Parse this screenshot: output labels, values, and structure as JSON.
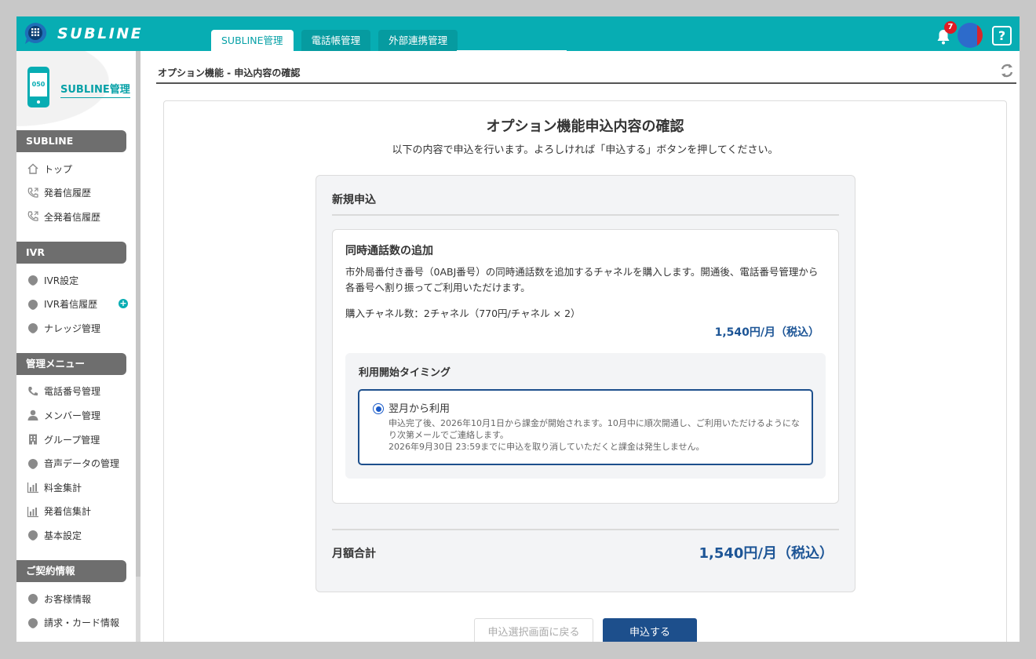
{
  "app": {
    "logo_text": "SUBLINE",
    "tabs": [
      {
        "label": "SUBLINE管理",
        "active": true
      },
      {
        "label": "電話帳管理",
        "active": false
      },
      {
        "label": "外部連携管理",
        "active": false
      }
    ],
    "notification_count": "7",
    "help_label": "?",
    "accent_color": "#07adb3",
    "primary_color": "#1d4f8c"
  },
  "sidebar": {
    "phone_number_prefix": "050",
    "title": "SUBLINE管理",
    "sections": [
      {
        "heading": "SUBLINE",
        "items": [
          {
            "label": "トップ",
            "icon": "home-icon"
          },
          {
            "label": "発着信履歴",
            "icon": "phone-call-icon"
          },
          {
            "label": "全発着信履歴",
            "icon": "phone-call-icon"
          }
        ]
      },
      {
        "heading": "IVR",
        "items": [
          {
            "label": "IVR設定",
            "icon": "pin-icon"
          },
          {
            "label": "IVR着信履歴",
            "icon": "pin-icon"
          },
          {
            "label": "ナレッジ管理",
            "icon": "pin-icon"
          }
        ]
      },
      {
        "heading": "管理メニュー",
        "items": [
          {
            "label": "電話番号管理",
            "icon": "phone-icon"
          },
          {
            "label": "メンバー管理",
            "icon": "user-icon"
          },
          {
            "label": "グループ管理",
            "icon": "building-icon"
          },
          {
            "label": "音声データの管理",
            "icon": "pin-icon"
          },
          {
            "label": "料金集計",
            "icon": "bar-chart-icon"
          },
          {
            "label": "発着信集計",
            "icon": "bar-chart-icon"
          },
          {
            "label": "基本設定",
            "icon": "pin-icon"
          }
        ]
      },
      {
        "heading": "ご契約情報",
        "items": [
          {
            "label": "お客様情報",
            "icon": "pin-icon"
          },
          {
            "label": "請求・カード情報",
            "icon": "pin-icon"
          }
        ]
      }
    ]
  },
  "main": {
    "breadcrumb": "オプション機能 - 申込内容の確認",
    "title": "オプション機能申込内容の確認",
    "subtitle": "以下の内容で申込を行います。よろしければ「申込する」ボタンを押してください。",
    "panel": {
      "title": "新規申込",
      "item": {
        "title": "同時通話数の追加",
        "description": "市外局番付き番号（0ABJ番号）の同時通話数を追加するチャネルを購入します。開通後、電話番号管理から各番号へ割り振ってご利用いただけます。",
        "quantity": "購入チャネル数：2チャネル（770円/チャネル × 2）",
        "price": "1,540円/月（税込）",
        "timing": {
          "title": "利用開始タイミング",
          "option_label": "翌月から利用",
          "note_line1": "申込完了後、2026年10月1日から課金が開始されます。10月中に順次開通し、ご利用いただけるようになり次第メールでご連絡します。",
          "note_line2": "2026年9月30日 23:59までに申込を取り消していただくと課金は発生しません。"
        }
      },
      "total_label": "月額合計",
      "total_value": "1,540円/月（税込）"
    },
    "back_button": "申込選択画面に戻る",
    "submit_button": "申込する"
  }
}
